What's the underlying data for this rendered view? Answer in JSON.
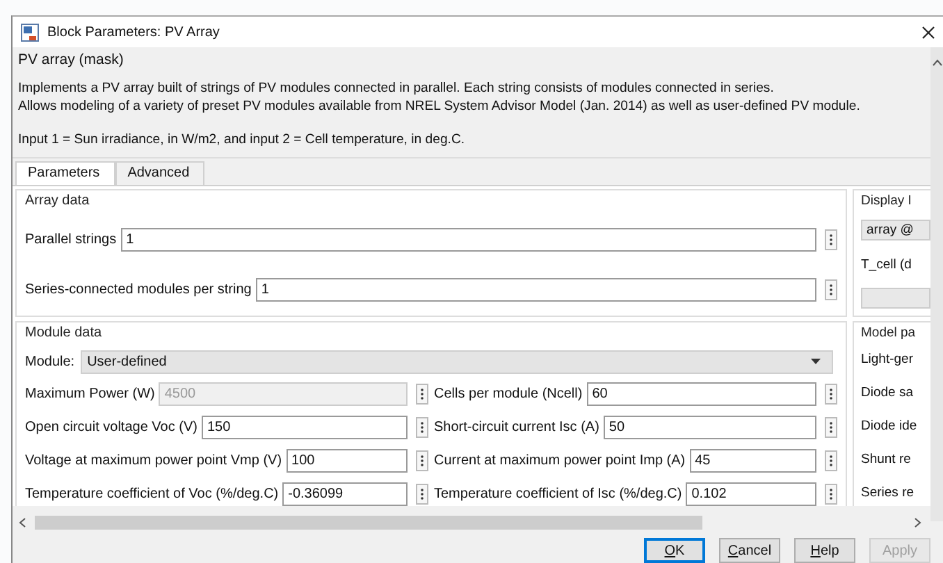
{
  "window": {
    "title": "Block Parameters: PV Array"
  },
  "mask": {
    "title": "PV array (mask)",
    "description": [
      "Implements a PV array built of strings of PV modules connected in parallel. Each string consists of modules connected in series.",
      "Allows modeling of a variety of preset PV modules available from NREL System Advisor Model (Jan. 2014) as well as user-defined PV module."
    ],
    "inputs": "Input 1 = Sun irradiance, in W/m2, and input 2 = Cell temperature, in deg.C."
  },
  "tabs": [
    {
      "label": "Parameters",
      "selected": true
    },
    {
      "label": "Advanced",
      "selected": false
    }
  ],
  "array_data": {
    "title": "Array data",
    "fields": [
      {
        "label": "Parallel strings",
        "value": "1"
      },
      {
        "label": "Series-connected modules per string",
        "value": "1"
      }
    ]
  },
  "module_data": {
    "title": "Module data",
    "module": {
      "label": "Module:",
      "value": "User-defined"
    },
    "fields": [
      {
        "label": "Maximum Power (W)",
        "value": "4500",
        "disabled": true
      },
      {
        "label": "Cells per module (Ncell)",
        "value": "60",
        "disabled": false
      },
      {
        "label": "Open circuit voltage  Voc (V)",
        "value": "150",
        "disabled": false
      },
      {
        "label": "Short-circuit current Isc (A)",
        "value": "50",
        "disabled": false
      },
      {
        "label": "Voltage at maximum power point Vmp (V)",
        "value": "100",
        "disabled": false
      },
      {
        "label": "Current at maximum power point Imp (A)",
        "value": "45",
        "disabled": false
      },
      {
        "label": "Temperature coefficient of Voc (%/deg.C)",
        "value": "-0.36099",
        "disabled": false
      },
      {
        "label": "Temperature coefficient of Isc (%/deg.C)",
        "value": "0.102",
        "disabled": false
      }
    ]
  },
  "side_panels": [
    {
      "title": "Display I",
      "items": [
        {
          "kind": "field",
          "value": "array @"
        },
        {
          "kind": "label",
          "text": "T_cell (d"
        },
        {
          "kind": "field"
        }
      ]
    },
    {
      "title": "Model pa",
      "items": [
        {
          "kind": "label",
          "text": "Light-ger"
        },
        {
          "kind": "label",
          "text": "Diode sa"
        },
        {
          "kind": "label",
          "text": "Diode ide"
        },
        {
          "kind": "label",
          "text": "Shunt re"
        },
        {
          "kind": "label",
          "text": "Series re"
        }
      ]
    }
  ],
  "buttons": [
    {
      "label": "OK",
      "default": true,
      "disabled": false
    },
    {
      "label": "Cancel",
      "default": false,
      "disabled": false
    },
    {
      "label": "Help",
      "default": false,
      "disabled": false
    },
    {
      "label": "Apply",
      "default": false,
      "disabled": true
    }
  ]
}
